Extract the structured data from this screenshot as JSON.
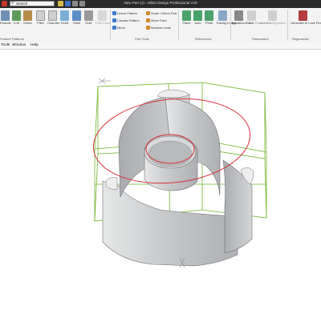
{
  "window": {
    "title": "New Part (1) - Alibre Design Professional V19"
  },
  "search": {
    "placeholder": "Search"
  },
  "colors": {
    "titlebar": "#2a2a2a",
    "ribbon": "#f3f3f3",
    "construct_green": "#6fb52a",
    "sketch_red": "#d9303a",
    "body_gray": "#c4c6c8"
  },
  "ribbon": {
    "tools": [
      {
        "label": "Extrude",
        "icon": "extrude-icon"
      },
      {
        "label": "Loft",
        "icon": "loft-icon"
      },
      {
        "label": "Holes",
        "icon": "holes-icon"
      },
      {
        "label": "Fillet",
        "icon": "fillet-icon"
      },
      {
        "label": "Chamfer",
        "icon": "chamfer-icon"
      },
      {
        "label": "Draft",
        "icon": "draft-icon"
      },
      {
        "label": "Shell",
        "icon": "shell-icon"
      },
      {
        "label": "Hole",
        "icon": "hole-icon"
      },
      {
        "label": "Fold Close",
        "icon": "fold-icon"
      }
    ],
    "pattern_tools": [
      "Linear Pattern",
      "Circular Pattern",
      "Mirror"
    ],
    "part_tools": [
      "Scale / Mirror Part",
      "Move Face",
      "Boolean Units"
    ],
    "ref_tools": [
      {
        "label": "Plane",
        "icon": "plane-icon"
      },
      {
        "label": "Axis",
        "icon": "axis-icon"
      },
      {
        "label": "Point",
        "icon": "point-icon"
      },
      {
        "label": "Tracing Image",
        "icon": "image-icon"
      }
    ],
    "param_tools": [
      {
        "label": "Equation Editor",
        "icon": "equation-icon"
      },
      {
        "label": "Global Parameters",
        "icon": "global-params-icon"
      },
      {
        "label": "New Configuration",
        "icon": "configuration-icon"
      }
    ],
    "regen_tool": {
      "label": "Generate to Lock Feature",
      "icon": "regenerate-icon"
    },
    "groups": [
      "Feature Patterns",
      "Part Tools",
      "References",
      "Parameters",
      "Regenerate"
    ]
  },
  "menu": [
    "Tools",
    "Window",
    "Help"
  ]
}
